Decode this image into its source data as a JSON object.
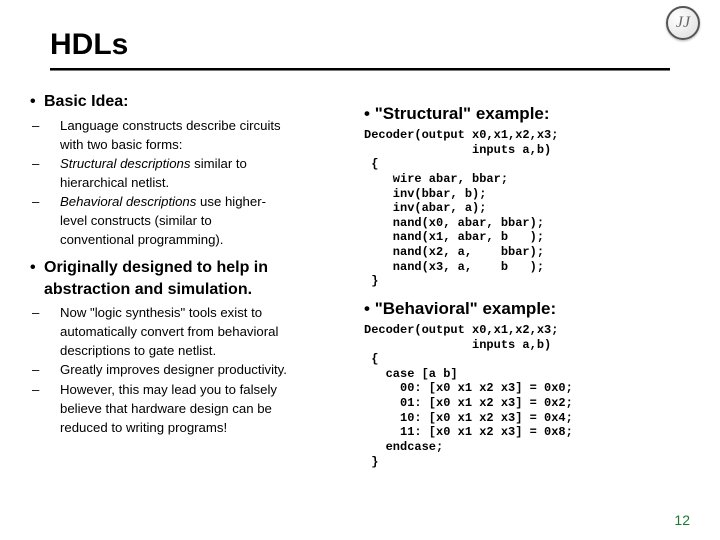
{
  "logo_text": "JJ",
  "title": "HDLs",
  "left": {
    "h1": "Basic Idea:",
    "b1a": "Language constructs describe circuits",
    "b1b": "with two basic forms:",
    "b2a_i": "Structural descriptions",
    "b2a_t": " similar to",
    "b2b": "hierarchical netlist.",
    "b3a_i": "Behavioral descriptions",
    "b3a_t": " use higher-",
    "b3b": "level constructs (similar to",
    "b3c": "conventional programming).",
    "h2a": "Originally designed to help in",
    "h2b": "abstraction and simulation.",
    "c1a": "Now \"logic synthesis\" tools exist to",
    "c1b": "automatically convert from behavioral",
    "c1c": "descriptions to gate netlist.",
    "c2": "Greatly improves designer productivity.",
    "c3a": "However, this may lead you to falsely",
    "c3b": "believe that hardware design can be",
    "c3c": "reduced to writing programs!"
  },
  "right": {
    "h1": "\"Structural\" example:",
    "code1": "Decoder(output x0,x1,x2,x3;\n               inputs a,b)\n {\n    wire abar, bbar;\n    inv(bbar, b);\n    inv(abar, a);\n    nand(x0, abar, bbar);\n    nand(x1, abar, b   );\n    nand(x2, a,    bbar);\n    nand(x3, a,    b   );\n }",
    "h2": "\"Behavioral\" example:",
    "code2": "Decoder(output x0,x1,x2,x3;\n               inputs a,b)\n {\n   case [a b]\n     00: [x0 x1 x2 x3] = 0x0;\n     01: [x0 x1 x2 x3] = 0x2;\n     10: [x0 x1 x2 x3] = 0x4;\n     11: [x0 x1 x2 x3] = 0x8;\n   endcase;\n }"
  },
  "page_num": "12"
}
